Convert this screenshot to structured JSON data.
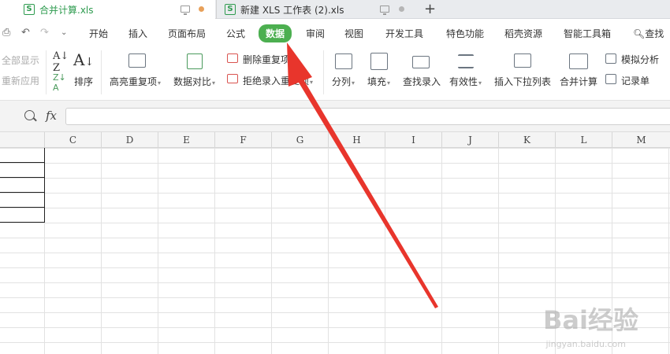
{
  "tabs": [
    {
      "label": "合并计算.xls",
      "active": true
    },
    {
      "label": "新建 XLS 工作表 (2).xls",
      "active": false
    }
  ],
  "menu": {
    "items": [
      "开始",
      "插入",
      "页面布局",
      "公式",
      "数据",
      "审阅",
      "视图",
      "开发工具",
      "特色功能",
      "稻壳资源",
      "智能工具箱"
    ],
    "active_index": 4,
    "search_label": "查找"
  },
  "ribbon": {
    "show_all": "全部显示",
    "reapply": "重新应用",
    "sort": "排序",
    "highlight_dup": "高亮重复项",
    "data_compare": "数据对比",
    "remove_dup": "删除重复项",
    "reject_dup": "拒绝录入重复项",
    "split_col": "分列",
    "fill": "填充",
    "lookup_entry": "查找录入",
    "validity": "有效性",
    "insert_dropdown": "插入下拉列表",
    "consolidate": "合并计算",
    "simulate": "模拟分析",
    "record_sheet": "记录单"
  },
  "formula_bar": {
    "fx": "fx",
    "value": ""
  },
  "columns": [
    "C",
    "D",
    "E",
    "F",
    "G",
    "H",
    "I",
    "J",
    "K",
    "L",
    "M"
  ],
  "watermark": {
    "brand": "Bai经验",
    "url": "jingyan.baidu.com"
  },
  "colors": {
    "accent": "#4caf50",
    "arrow": "#e8352c",
    "tab_dot": "#e8a05a",
    "sheet_icon": "#2e9b4f"
  }
}
